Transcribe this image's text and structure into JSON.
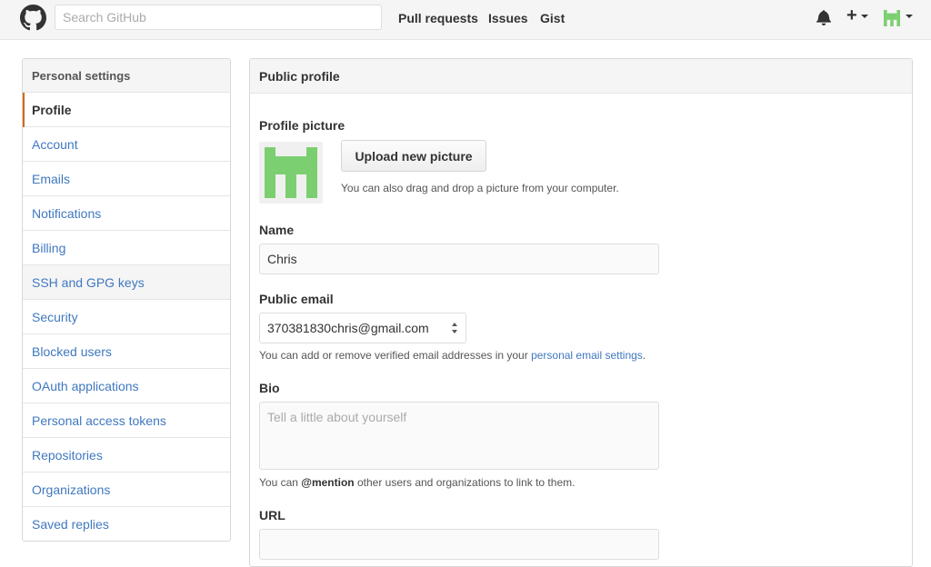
{
  "header": {
    "search_placeholder": "Search GitHub",
    "nav": [
      "Pull requests",
      "Issues",
      "Gist"
    ],
    "icons": [
      "github-logo",
      "bell-icon",
      "plus-icon",
      "avatar"
    ]
  },
  "sidebar": {
    "title": "Personal settings",
    "items": [
      {
        "label": "Profile"
      },
      {
        "label": "Account"
      },
      {
        "label": "Emails"
      },
      {
        "label": "Notifications"
      },
      {
        "label": "Billing"
      },
      {
        "label": "SSH and GPG keys"
      },
      {
        "label": "Security"
      },
      {
        "label": "Blocked users"
      },
      {
        "label": "OAuth applications"
      },
      {
        "label": "Personal access tokens"
      },
      {
        "label": "Repositories"
      },
      {
        "label": "Organizations"
      },
      {
        "label": "Saved replies"
      }
    ]
  },
  "profile": {
    "title": "Public profile",
    "picture_label": "Profile picture",
    "upload_button": "Upload new picture",
    "picture_hint": "You can also drag and drop a picture from your computer.",
    "name_label": "Name",
    "name_value": "Chris",
    "email_label": "Public email",
    "email_value": "370381830chris@gmail.com",
    "email_hint_prefix": "You can add or remove verified email addresses in your ",
    "email_hint_link": "personal email settings",
    "email_hint_suffix": ".",
    "bio_label": "Bio",
    "bio_placeholder": "Tell a little about yourself",
    "bio_hint_prefix": "You can ",
    "bio_hint_bold": "@mention",
    "bio_hint_suffix": " other users and organizations to link to them.",
    "url_label": "URL"
  },
  "colors": {
    "link": "#4078c0",
    "selected_accent": "#d26911",
    "avatar_green": "#7ccf70"
  }
}
